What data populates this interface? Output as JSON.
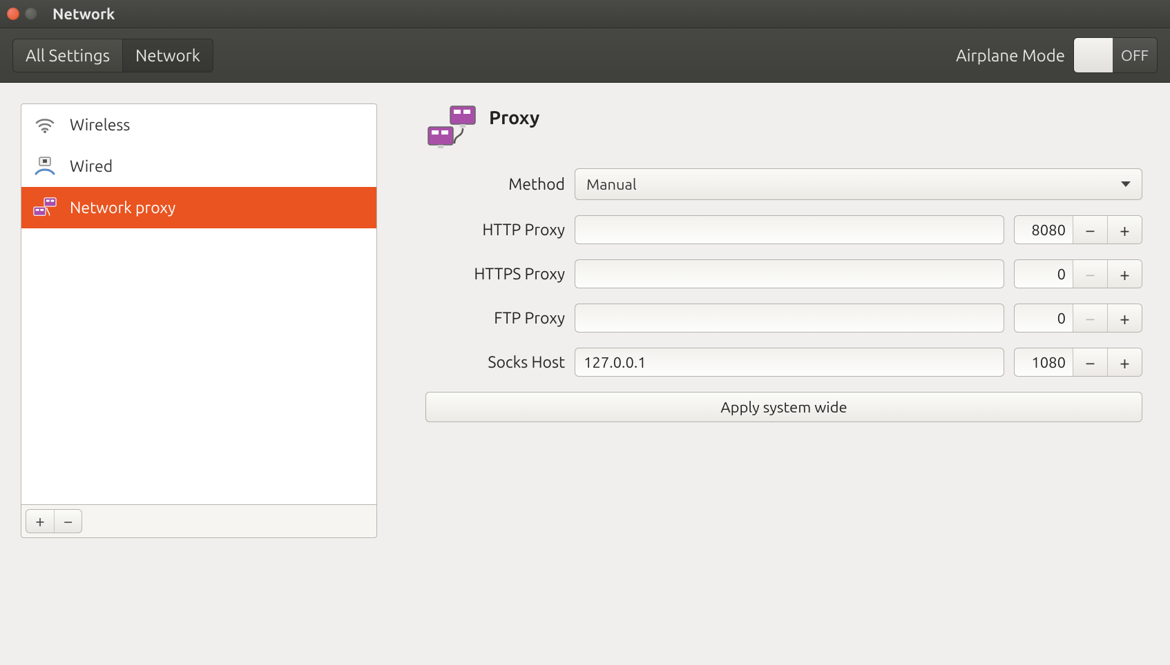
{
  "window": {
    "title": "Network"
  },
  "toolbar": {
    "all_settings": "All Settings",
    "network": "Network",
    "airplane_label": "Airplane Mode",
    "airplane_state": "OFF"
  },
  "sidebar": {
    "items": [
      {
        "label": "Wireless",
        "icon": "wifi-icon",
        "selected": false
      },
      {
        "label": "Wired",
        "icon": "ethernet-icon",
        "selected": false
      },
      {
        "label": "Network proxy",
        "icon": "proxy-icon",
        "selected": true
      }
    ],
    "add_label": "+",
    "remove_label": "−"
  },
  "pane": {
    "title": "Proxy",
    "method_label": "Method",
    "method_value": "Manual",
    "rows": [
      {
        "label": "HTTP Proxy",
        "host": "",
        "port": "8080",
        "minus_disabled": false
      },
      {
        "label": "HTTPS Proxy",
        "host": "",
        "port": "0",
        "minus_disabled": true
      },
      {
        "label": "FTP Proxy",
        "host": "",
        "port": "0",
        "minus_disabled": true
      },
      {
        "label": "Socks Host",
        "host": "127.0.0.1",
        "port": "1080",
        "minus_disabled": false
      }
    ],
    "apply_label": "Apply system wide"
  }
}
